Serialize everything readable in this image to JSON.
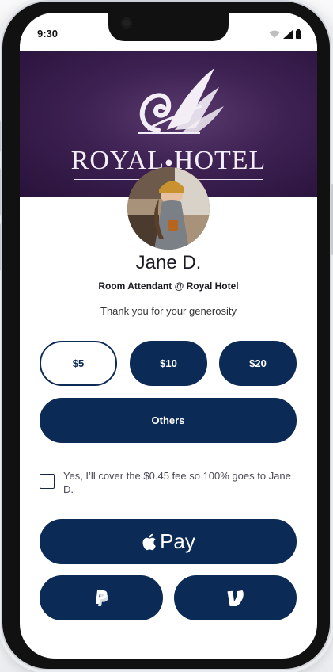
{
  "status_bar": {
    "time": "9:30"
  },
  "banner": {
    "logo_text_royal": "ROYAL",
    "logo_text_hotel": "HOTEL",
    "colors": {
      "bg": "#3d2152"
    }
  },
  "profile": {
    "name": "Jane D.",
    "role": "Room Attendant @ Royal Hotel",
    "message": "Thank you for your generosity"
  },
  "amounts": [
    {
      "label": "$5",
      "selected": true
    },
    {
      "label": "$10",
      "selected": false
    },
    {
      "label": "$20",
      "selected": false
    }
  ],
  "others_label": "Others",
  "fee_option": {
    "checked": false,
    "text": "Yes, I’ll cover the $0.45 fee so 100% goes to Jane D."
  },
  "payments": {
    "apple_pay_label": "Pay",
    "apple_icon": "apple-icon",
    "paypal_icon": "paypal-icon",
    "venmo_icon": "venmo-icon"
  },
  "colors": {
    "primary": "#0b2a55",
    "text": "#1a1a22"
  }
}
